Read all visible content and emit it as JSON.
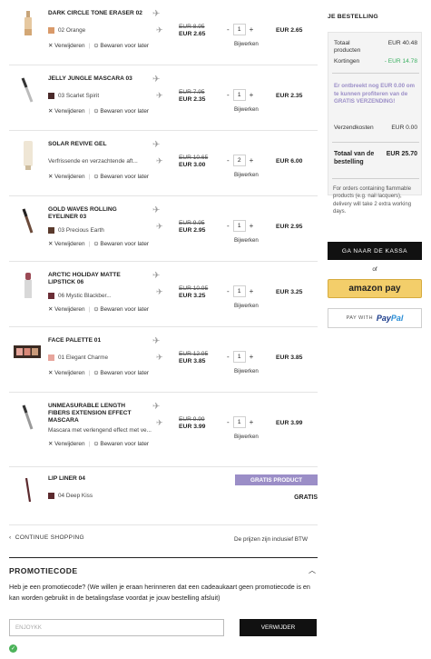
{
  "labels": {
    "remove": "Verwijderen",
    "save_later": "Bewaren voor later",
    "update": "Bijwerken",
    "minus": "-",
    "plus": "+"
  },
  "items": [
    {
      "name": "DARK CIRCLE TONE ERASER 02",
      "shade": "02 Orange",
      "swatch": "#d99a6a",
      "old": "EUR 8.95",
      "now": "EUR 2.65",
      "qty": "1",
      "total": "EUR 2.65"
    },
    {
      "name": "JELLY JUNGLE MASCARA 03",
      "shade": "03 Scarlet Spirit",
      "swatch": "#4a2a2a",
      "old": "EUR 7.95",
      "now": "EUR 2.35",
      "qty": "1",
      "total": "EUR 2.35"
    },
    {
      "name": "SOLAR REVIVE GEL",
      "desc": "Verfrissende en verzachtende aft...",
      "old": "EUR 10.65",
      "now": "EUR 3.00",
      "qty": "2",
      "total": "EUR 6.00"
    },
    {
      "name": "GOLD WAVES ROLLING EYELINER 03",
      "shade": "03 Precious Earth",
      "swatch": "#5a3a2c",
      "old": "EUR 9.95",
      "now": "EUR 2.95",
      "qty": "1",
      "total": "EUR 2.95"
    },
    {
      "name": "ARCTIC HOLIDAY MATTE LIPSTICK 06",
      "shade": "06 Mystic Blackber...",
      "swatch": "#6b2e36",
      "old": "EUR 10.95",
      "now": "EUR 3.25",
      "qty": "1",
      "total": "EUR 3.25"
    },
    {
      "name": "FACE PALETTE 01",
      "shade": "01 Elegant Charme",
      "swatch": "#e7a59c",
      "old": "EUR 12.95",
      "now": "EUR 3.85",
      "qty": "1",
      "total": "EUR 3.85"
    },
    {
      "name": "UNMEASURABLE LENGTH FIBERS EXTENSION EFFECT MASCARA",
      "desc": "Mascara met verlengend effect met ve...",
      "old": "EUR 9.99",
      "now": "EUR 3.99",
      "qty": "1",
      "total": "EUR 3.99"
    }
  ],
  "free_item": {
    "name": "LIP LINER 04",
    "shade": "04 Deep Kiss",
    "swatch": "#5c2a2e",
    "badge": "GRATIS PRODUCT",
    "price": "GRATIS"
  },
  "footer": {
    "continue": "CONTINUE SHOPPING",
    "vat": "De prijzen zijn inclusief BTW"
  },
  "promo": {
    "title": "PROMOTIECODE",
    "text": "Heb je een promotiecode? (We willen je eraan herinneren dat een cadeaukaart geen promotiecode is en kan worden gebruikt in de betalingsfase voordat je jouw bestelling afsluit)",
    "input_value": "ENJOYKK",
    "button": "VERWIJDER"
  },
  "order": {
    "title": "JE BESTELLING",
    "total_products_label": "Totaal producten",
    "total_products": "EUR 40.48",
    "discounts_label": "Kortingen",
    "discounts": "- EUR 14.78",
    "free_ship_note": "Er ontbreekt nog EUR 0.00 om te kunnen profiteren van de GRATIS VERZENDING!",
    "shipping_label": "Verzendkosten",
    "shipping": "EUR 0.00",
    "grand_total_label": "Totaal van de bestelling",
    "grand_total": "EUR 25.70",
    "flammable_note": "For orders containing flammable products (e.g. nail lacquers), delivery will take 2 extra working days.",
    "checkout": "GA NAAR DE KASSA",
    "or": "of",
    "amazon": "amazon pay",
    "paypal_prefix": "PAY WITH",
    "paypal_brand_1": "Pay",
    "paypal_brand_2": "Pal"
  },
  "colors": {
    "accent_purple": "#9b8ec7",
    "discount_green": "#3cb062",
    "dark": "#111111"
  }
}
